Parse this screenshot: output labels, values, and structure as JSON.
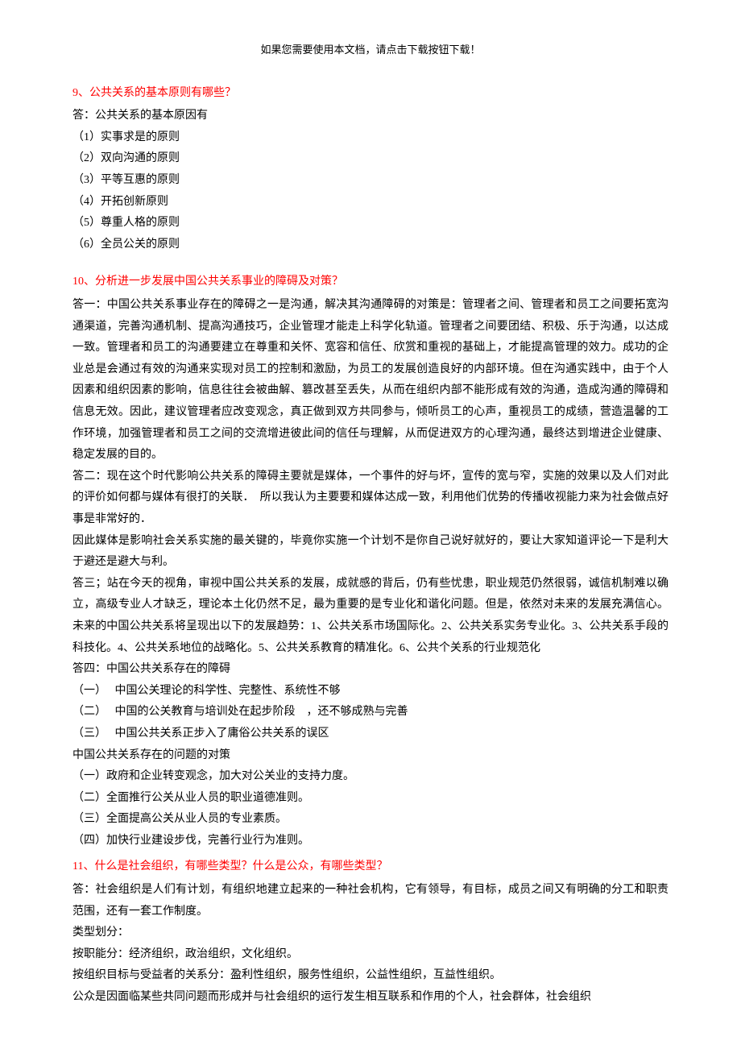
{
  "header_note": "如果您需要使用本文档，请点击下载按钮下载！",
  "q9": {
    "title": "9、公共关系的基本原则有哪些？",
    "intro": "答：公共关系的基本原因有",
    "items": [
      "（1）实事求是的原则",
      "（2）双向沟通的原则",
      "（3）平等互惠的原则",
      "（4）开拓创新原则",
      "（5）尊重人格的原则",
      "（6）全员公关的原则"
    ]
  },
  "q10": {
    "title": "10、分析进一步发展中国公共关系事业的障碍及对策？",
    "a1": "答一：中国公共关系事业存在的障碍之一是沟通，解决其沟通障碍的对策是：管理者之间、管理者和员工之间要拓宽沟通渠道，完善沟通机制、提高沟通技巧，企业管理才能走上科学化轨道。管理者之间要团结、积极、乐于沟通，以达成一致。管理者和员工的沟通要建立在尊重和关怀、宽容和信任、欣赏和重视的基础上，才能提高管理的效力。成功的企业总是会通过有效的沟通来实现对员工的控制和激励，为员工的发展创造良好的内部环境。但在沟通实践中，由于个人因素和组织因素的影响，信息往往会被曲解、篡改甚至丢失，从而在组织内部不能形成有效的沟通，造成沟通的障碍和信息无效。因此，建议管理者应改变观念，真正做到双方共同参与，倾听员工的心声，重视员工的成绩，营造温馨的工作环境，加强管理者和员工之间的交流增进彼此间的信任与理解，从而促进双方的心理沟通，最终达到增进企业健康、稳定发展的目的。",
    "a2p1": "答二：现在这个时代影响公共关系的障碍主要就是媒体，一个事件的好与坏，宣传的宽与窄，实施的效果以及人们对此的评价如何都与媒体有很打的关联．　所以我认为主要要和媒体达成一致，利用他们优势的传播收视能力来为社会做点好事是非常好的．",
    "a2p2": "因此媒体是影响社会关系实施的最关键的，毕竟你实施一个计划不是你自己说好就好的，要让大家知道评论一下是利大于避还是避大与利。",
    "a3": "答三；站在今天的视角，审视中国公共关系的发展，成就感的背后，仍有些忧患，职业规范仍然很弱，诚信机制难以确立，高级专业人才缺乏，理论本土化仍然不足，最为重要的是专业化和谐化问题。但是，依然对未来的发展充满信心。未来的中国公共关系将呈现出以下的发展趋势：1、公共关系市场国际化。2、公共关系实务专业化。3、公共关系手段的科技化。4、公共关系地位的战略化。5、公共关系教育的精准化。6、公共个关系的行业规范化",
    "a4_intro": "答四：中国公共关系存在的障碍",
    "a4_items": [
      "（一）　 中国公关理论的科学性、完整性、系统性不够",
      "（二）　 中国的公关教育与培训处在起步阶段　，还不够成熟与完善",
      "（三）　 中国公共关系正步入了庸俗公共关系的误区"
    ],
    "a4_counter_intro": "中国公共关系存在的问题的对策",
    "a4_counter_items": [
      "（一）政府和企业转变观念，加大对公关业的支持力度。",
      "（二）全面推行公关从业人员的职业道德准则。",
      "（三）全面提高公关从业人员的专业素质。",
      "（四）加快行业建设步伐，完善行业行为准则。"
    ]
  },
  "q11": {
    "title": "11、什么是社会组织，有哪些类型？什么是公众，有哪些类型？",
    "p1": "答：社会组织是人们有计划，有组织地建立起来的一种社会机构，它有领导，有目标，成员之间又有明确的分工和职责范围，还有一套工作制度。",
    "p2": "类型划分：",
    "p3": "按职能分：经济组织，政治组织，文化组织。",
    "p4": "按组织目标与受益者的关系分：盈利性组织，服务性组织，公益性组织，互益性组织。",
    "p5": "公众是因面临某些共同问题而形成并与社会组织的运行发生相互联系和作用的个人，社会群体，社会组织"
  }
}
